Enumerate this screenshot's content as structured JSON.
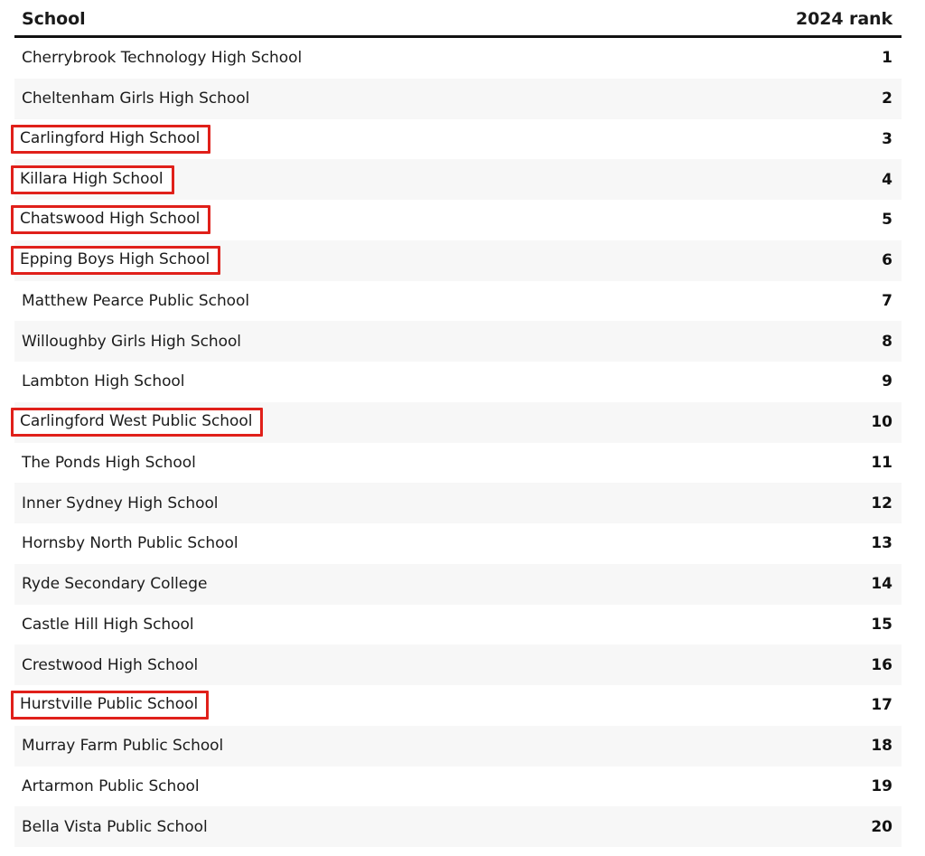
{
  "table": {
    "columns": {
      "school_header": "School",
      "rank_header": "2024 rank"
    },
    "highlight_color": "#e0201a",
    "row_alt_color": "#f7f7f7",
    "row_base_color": "#ffffff",
    "header_rule_color": "#111111",
    "rows": [
      {
        "school": "Cherrybrook Technology High School",
        "rank": "1",
        "highlighted": false
      },
      {
        "school": "Cheltenham Girls High School",
        "rank": "2",
        "highlighted": false
      },
      {
        "school": "Carlingford High School",
        "rank": "3",
        "highlighted": true
      },
      {
        "school": "Killara High School",
        "rank": "4",
        "highlighted": true
      },
      {
        "school": "Chatswood High School",
        "rank": "5",
        "highlighted": true
      },
      {
        "school": "Epping Boys High School",
        "rank": "6",
        "highlighted": true
      },
      {
        "school": "Matthew Pearce Public School",
        "rank": "7",
        "highlighted": false
      },
      {
        "school": "Willoughby Girls High School",
        "rank": "8",
        "highlighted": false
      },
      {
        "school": "Lambton High School",
        "rank": "9",
        "highlighted": false
      },
      {
        "school": "Carlingford West Public School",
        "rank": "10",
        "highlighted": true
      },
      {
        "school": "The Ponds High School",
        "rank": "11",
        "highlighted": false
      },
      {
        "school": "Inner Sydney High School",
        "rank": "12",
        "highlighted": false
      },
      {
        "school": "Hornsby North Public School",
        "rank": "13",
        "highlighted": false
      },
      {
        "school": "Ryde Secondary College",
        "rank": "14",
        "highlighted": false
      },
      {
        "school": "Castle Hill High School",
        "rank": "15",
        "highlighted": false
      },
      {
        "school": "Crestwood High School",
        "rank": "16",
        "highlighted": false
      },
      {
        "school": "Hurstville Public School",
        "rank": "17",
        "highlighted": true
      },
      {
        "school": "Murray Farm Public School",
        "rank": "18",
        "highlighted": false
      },
      {
        "school": "Artarmon Public School",
        "rank": "19",
        "highlighted": false
      },
      {
        "school": "Bella Vista Public School",
        "rank": "20",
        "highlighted": false
      }
    ]
  }
}
